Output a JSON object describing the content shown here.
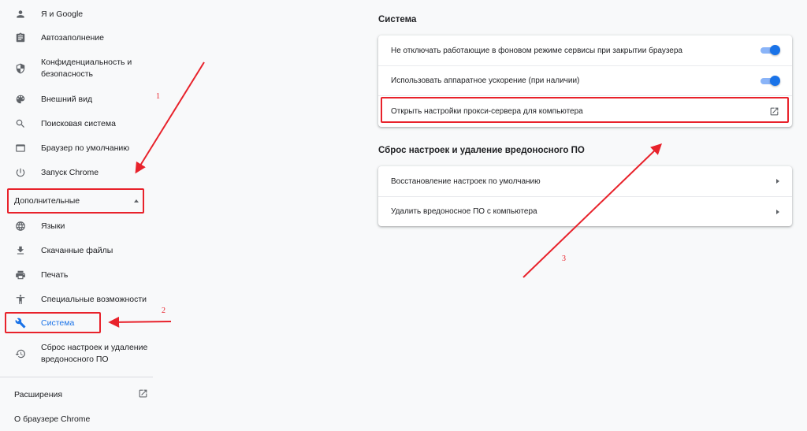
{
  "sidebar": {
    "items": [
      {
        "label": "Я и Google",
        "icon": "person-icon"
      },
      {
        "label": "Автозаполнение",
        "icon": "clipboard-icon"
      },
      {
        "label": "Конфиденциальность и безопасность",
        "icon": "shield-icon"
      },
      {
        "label": "Внешний вид",
        "icon": "palette-icon"
      },
      {
        "label": "Поисковая система",
        "icon": "search-icon"
      },
      {
        "label": "Браузер по умолчанию",
        "icon": "browser-window-icon"
      },
      {
        "label": "Запуск Chrome",
        "icon": "power-icon"
      }
    ],
    "advanced_label": "Дополнительные",
    "advanced_items": [
      {
        "label": "Языки",
        "icon": "globe-icon"
      },
      {
        "label": "Скачанные файлы",
        "icon": "download-icon"
      },
      {
        "label": "Печать",
        "icon": "printer-icon"
      },
      {
        "label": "Специальные возможности",
        "icon": "accessibility-icon"
      },
      {
        "label": "Система",
        "icon": "wrench-icon",
        "active": true
      },
      {
        "label": "Сброс настроек и удаление вредоносного ПО",
        "icon": "restore-icon"
      }
    ],
    "extensions_label": "Расширения",
    "about_label": "О браузере Chrome"
  },
  "main": {
    "system_title": "Система",
    "system_rows": [
      {
        "label": "Не отключать работающие в фоновом режиме сервисы при закрытии браузера",
        "control": "toggle",
        "on": true
      },
      {
        "label": "Использовать аппаратное ускорение (при наличии)",
        "control": "toggle",
        "on": true
      },
      {
        "label": "Открыть настройки прокси-сервера для компьютера",
        "control": "external-link-icon"
      }
    ],
    "reset_title": "Сброс настроек и удаление вредоносного ПО",
    "reset_rows": [
      {
        "label": "Восстановление настроек по умолчанию",
        "control": "arrow-right-icon"
      },
      {
        "label": "Удалить вредоносное ПО с компьютера",
        "control": "arrow-right-icon"
      }
    ]
  },
  "annotations": {
    "step1": "1",
    "step2": "2",
    "step3": "3"
  },
  "colors": {
    "accent": "#1a73e8",
    "annotation": "#e8222b",
    "background": "#f8f9fa"
  }
}
